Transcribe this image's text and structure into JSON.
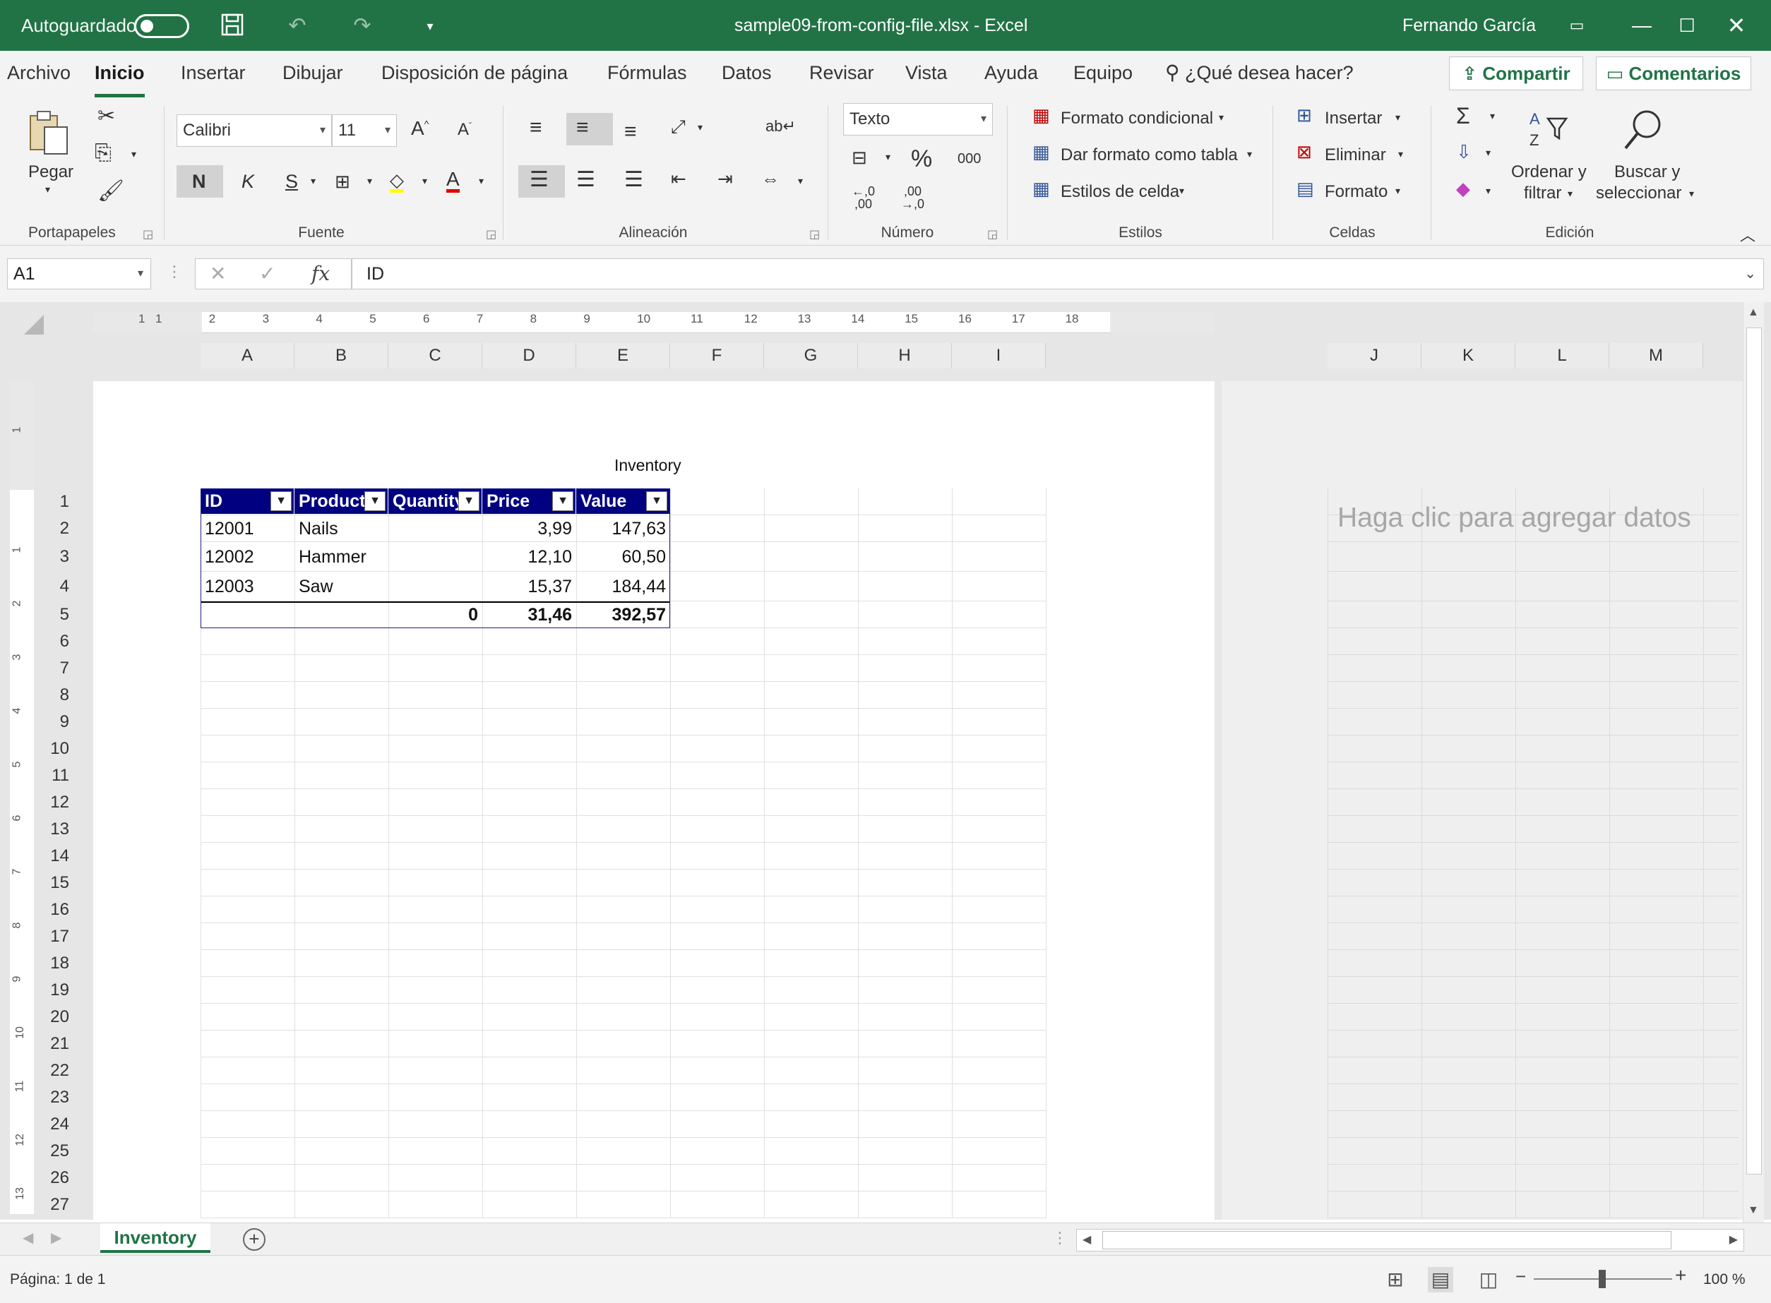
{
  "titlebar": {
    "autosave_label": "Autoguardado",
    "document_title": "sample09-from-config-file.xlsx  -  Excel",
    "user_name": "Fernando García",
    "save_icon": "save-icon",
    "undo_icon": "undo-icon",
    "redo_icon": "redo-icon"
  },
  "tabs": {
    "items": [
      "Archivo",
      "Inicio",
      "Insertar",
      "Dibujar",
      "Disposición de página",
      "Fórmulas",
      "Datos",
      "Revisar",
      "Vista",
      "Ayuda",
      "Equipo"
    ],
    "active": "Inicio",
    "tell_me": "¿Qué desea hacer?",
    "share": "Compartir",
    "comments": "Comentarios"
  },
  "ribbon": {
    "clipboard": {
      "paste": "Pegar",
      "label": "Portapapeles"
    },
    "font": {
      "name": "Calibri",
      "size": "11",
      "bold": "N",
      "italic": "K",
      "underline": "S",
      "label": "Fuente"
    },
    "alignment": {
      "label": "Alineación"
    },
    "number": {
      "format": "Texto",
      "thousands": "000",
      "label": "Número"
    },
    "styles": {
      "conditional": "Formato condicional",
      "as_table": "Dar formato como tabla",
      "cell_styles": "Estilos de celda",
      "label": "Estilos"
    },
    "cells": {
      "insert": "Insertar",
      "delete": "Eliminar",
      "format": "Formato",
      "label": "Celdas"
    },
    "editing": {
      "sort_line1": "Ordenar y",
      "sort_line2": "filtrar",
      "find_line1": "Buscar y",
      "find_line2": "seleccionar",
      "label": "Edición"
    }
  },
  "formula_bar": {
    "name_box": "A1",
    "fx": "fx",
    "formula": "ID"
  },
  "sheet": {
    "columns_left": [
      "A",
      "B",
      "C",
      "D",
      "E",
      "F",
      "G",
      "H",
      "I"
    ],
    "columns_right": [
      "J",
      "K",
      "L",
      "M"
    ],
    "rows": [
      "1",
      "2",
      "3",
      "4",
      "5",
      "6",
      "7",
      "8",
      "9",
      "10",
      "11",
      "12",
      "13",
      "14",
      "15",
      "16",
      "17",
      "18",
      "19",
      "20",
      "21",
      "22",
      "23",
      "24",
      "25",
      "26",
      "27"
    ],
    "ruler_h": [
      "1",
      "1",
      "2",
      "3",
      "4",
      "5",
      "6",
      "7",
      "8",
      "9",
      "10",
      "11",
      "12",
      "13",
      "14",
      "15",
      "16",
      "17",
      "18"
    ],
    "ruler_v": [
      "1",
      "1",
      "2",
      "3",
      "4",
      "5",
      "6",
      "7",
      "8",
      "9",
      "10",
      "11",
      "12",
      "13"
    ],
    "page_header": "Inventory",
    "placeholder": "Haga clic para agregar datos",
    "table": {
      "headers": [
        "ID",
        "Product",
        "Quantity",
        "Price",
        "Value"
      ],
      "rows": [
        [
          "12001",
          "Nails",
          "",
          "3,99",
          "147,63"
        ],
        [
          "12002",
          "Hammer",
          "",
          "12,10",
          "60,50"
        ],
        [
          "12003",
          "Saw",
          "",
          "15,37",
          "184,44"
        ]
      ],
      "totals": [
        "",
        "",
        "0",
        "31,46",
        "392,57"
      ]
    },
    "tab_name": "Inventory"
  },
  "statusbar": {
    "page_info": "Página: 1 de 1",
    "zoom": "100 %"
  }
}
